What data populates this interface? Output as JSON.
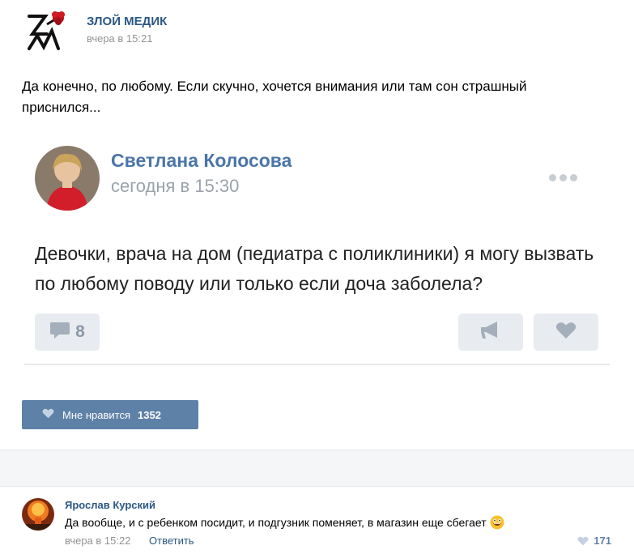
{
  "post": {
    "author": "ЗЛОЙ МЕДИК",
    "time": "вчера в 15:21",
    "text": "Да конечно, по любому. Если скучно, хочется внимания или там сон страшный приснился...",
    "logo_icon": "zm-logo-with-flower"
  },
  "embedded": {
    "author": "Светлана Колосова",
    "time": "сегодня в 15:30",
    "text": "Девочки, врача на дом (педиатра с поликлиники) я могу вызвать по любому поводу или только если доча заболела?",
    "comments_count": "8",
    "icons": [
      "comment-icon",
      "share-megaphone-icon",
      "like-heart-icon",
      "more-dots-icon"
    ]
  },
  "like_button": {
    "label": "Мне нравится",
    "count": "1352"
  },
  "comment": {
    "author": "Ярослав Курский",
    "text": "Да вообще, и с ребенком посидит, и подгузник поменяет, в магазин еще сбегает",
    "time": "вчера в 15:22",
    "reply_label": "Ответить",
    "likes": "171",
    "emoji": "grinning-face-emoji"
  },
  "colors": {
    "link": "#2a5885",
    "accent": "#5e81a8",
    "muted": "#939393"
  }
}
